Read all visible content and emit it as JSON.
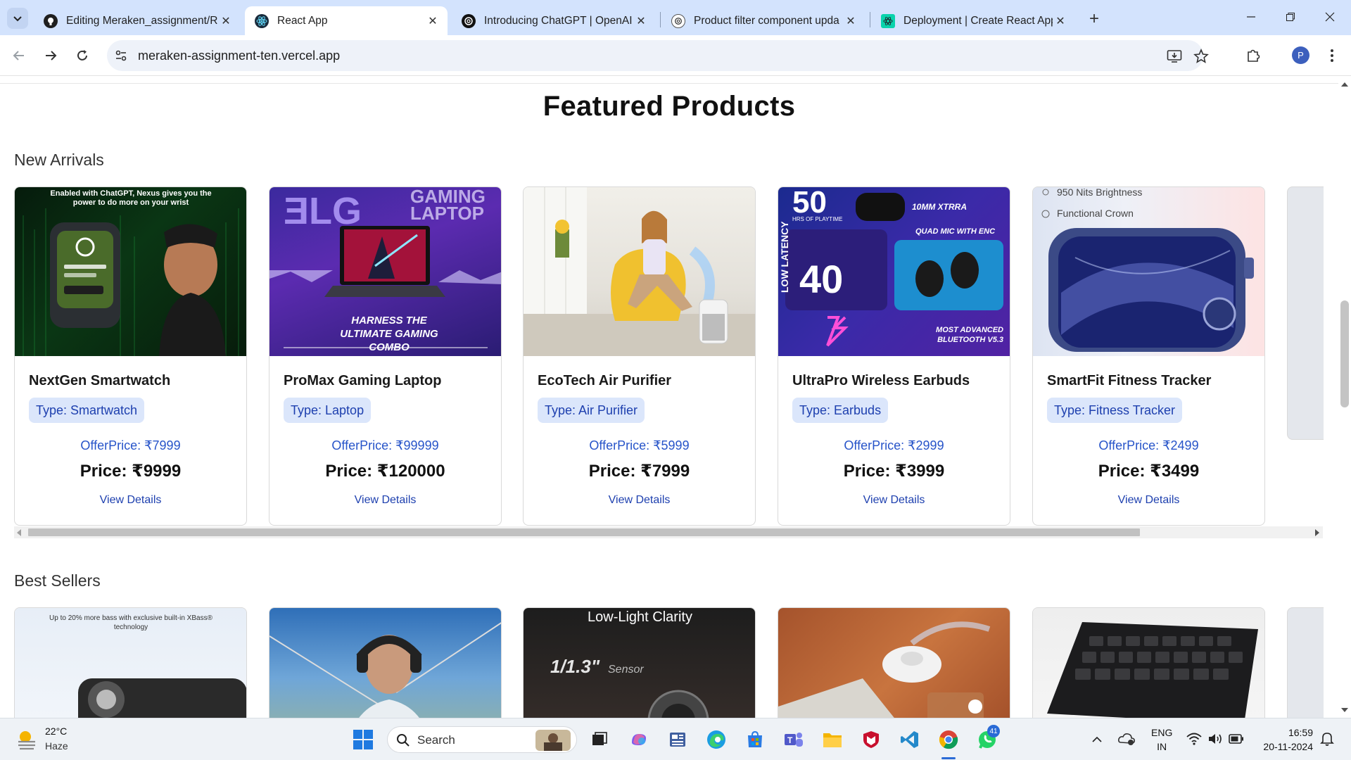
{
  "browser": {
    "tabs": [
      {
        "title": "Editing Meraken_assignment/R",
        "favicon": "github-icon",
        "active": false
      },
      {
        "title": "React App",
        "favicon": "react-icon",
        "active": true
      },
      {
        "title": "Introducing ChatGPT | OpenAI",
        "favicon": "openai-icon",
        "active": false
      },
      {
        "title": "Product filter component upda",
        "favicon": "openai-icon",
        "active": false
      },
      {
        "title": "Deployment | Create React App",
        "favicon": "react-icon",
        "active": false
      }
    ],
    "url": "meraken-assignment-ten.vercel.app",
    "profile_initial": "P"
  },
  "page": {
    "heading": "Featured Products",
    "sections": [
      {
        "title": "New Arrivals",
        "products": [
          {
            "name": "NextGen Smartwatch",
            "type": "Type: Smartwatch",
            "offer": "OfferPrice: ₹7999",
            "price": "Price: ₹9999",
            "details": "View Details",
            "image_caption": "Enabled with ChatGPT, Nexus gives you the power to do more on your wrist"
          },
          {
            "name": "ProMax Gaming Laptop",
            "type": "Type: Laptop",
            "offer": "OfferPrice: ₹99999",
            "price": "Price: ₹120000",
            "details": "View Details",
            "image_caption": "HARNESS THE ULTIMATE GAMING COMBO"
          },
          {
            "name": "EcoTech Air Purifier",
            "type": "Type: Air Purifier",
            "offer": "OfferPrice: ₹5999",
            "price": "Price: ₹7999",
            "details": "View Details",
            "image_caption": ""
          },
          {
            "name": "UltraPro Wireless Earbuds",
            "type": "Type: Earbuds",
            "offer": "OfferPrice: ₹2999",
            "price": "Price: ₹3999",
            "details": "View Details",
            "image_caption": "MOST ADVANCED BLUETOOTH V5.3"
          },
          {
            "name": "SmartFit Fitness Tracker",
            "type": "Type: Fitness Tracker",
            "offer": "OfferPrice: ₹2499",
            "price": "Price: ₹3499",
            "details": "View Details",
            "image_caption": "950 Nits Brightness"
          }
        ]
      },
      {
        "title": "Best Sellers",
        "image_captions": [
          "Up to 20% more bass with exclusive built-in XBass® technology",
          "",
          "Low-Light Clarity",
          "",
          ""
        ]
      }
    ]
  },
  "taskbar": {
    "weather_temp": "22°C",
    "weather_desc": "Haze",
    "search_label": "Search",
    "whatsapp_badge": "41",
    "lang_line1": "ENG",
    "lang_line2": "IN",
    "time": "16:59",
    "date": "20-11-2024"
  },
  "colors": {
    "accent_blue": "#1e40af",
    "offer_blue": "#2754c9",
    "type_badge_bg": "#dbe6fb",
    "tabstrip_bg": "#d3e3fd"
  }
}
